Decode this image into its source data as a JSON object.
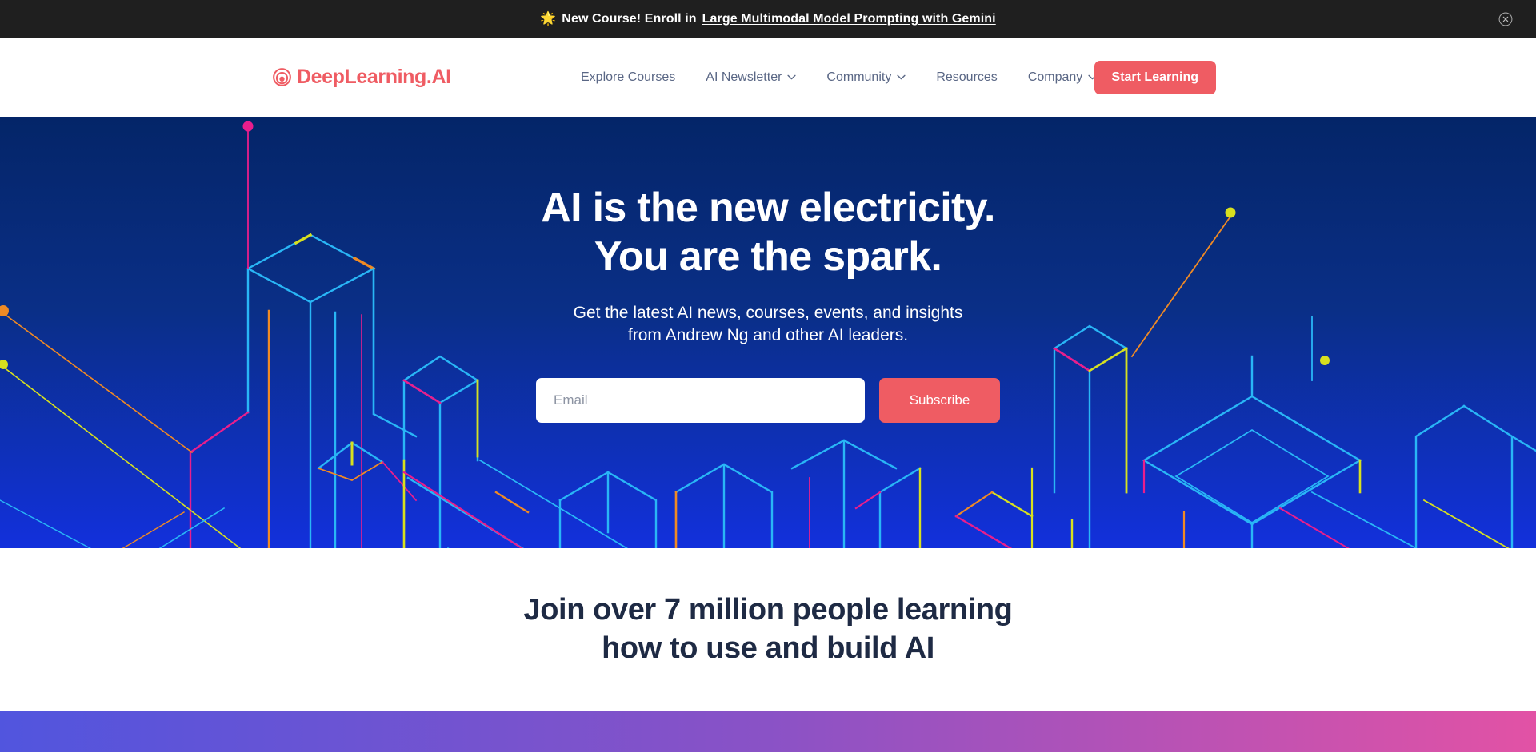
{
  "announcement": {
    "star_icon": "🌟",
    "prefix": "New Course! Enroll in",
    "link_text": "Large Multimodal Model Prompting with Gemini",
    "close_icon": "close-circle-icon"
  },
  "header": {
    "brand_name": "DeepLearning.AI",
    "brand_icon": "deeplearning-spiral-logo",
    "nav": [
      {
        "label": "Explore Courses",
        "has_dropdown": false
      },
      {
        "label": "AI Newsletter",
        "has_dropdown": true
      },
      {
        "label": "Community",
        "has_dropdown": true
      },
      {
        "label": "Resources",
        "has_dropdown": false
      },
      {
        "label": "Company",
        "has_dropdown": true
      }
    ],
    "cta_label": "Start Learning"
  },
  "hero": {
    "title_line1": "AI is the new electricity.",
    "title_line2": "You are the spark.",
    "subtitle_line1": "Get the latest AI news, courses, events, and insights",
    "subtitle_line2": "from Andrew Ng and other AI leaders.",
    "email_placeholder": "Email",
    "email_value": "",
    "subscribe_label": "Subscribe"
  },
  "stats": {
    "heading_line1": "Join over 7 million people learning",
    "heading_line2": "how to use and build AI"
  },
  "colors": {
    "accent_coral": "#ef5c63",
    "banner_bg": "#1f1f1f",
    "hero_top": "#042568",
    "hero_bottom": "#1230dc",
    "nav_text": "#5a6785",
    "heading_navy": "#1e2a44",
    "gradient_start": "#5155de",
    "gradient_mid": "#8a52c6",
    "gradient_end": "#e252a5",
    "art_cyan": "#29b6f6",
    "art_magenta": "#e91e8c",
    "art_yellow": "#d7e01f",
    "art_orange": "#f08a24"
  }
}
